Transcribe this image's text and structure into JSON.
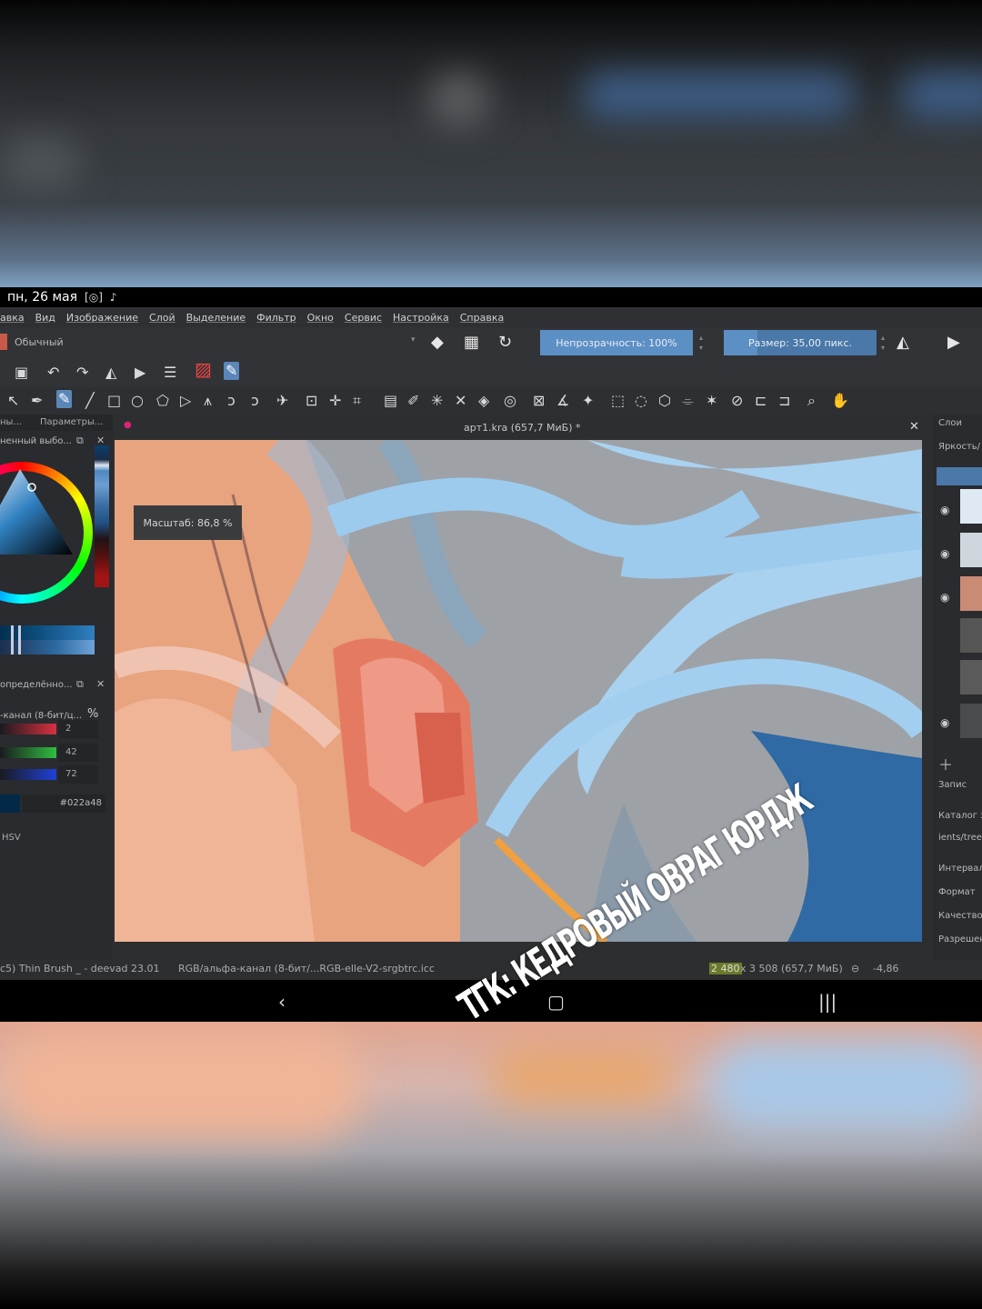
{
  "status_bar": {
    "date": "пн, 26 мая"
  },
  "menu": [
    "авка",
    "Вид",
    "Изображение",
    "Слой",
    "Выделение",
    "Фильтр",
    "Окно",
    "Сервис",
    "Настройка",
    "Справка"
  ],
  "brush_toolbar": {
    "preset": "Обычный",
    "opacity_label": "Непрозрачность: 100%",
    "opacity_value": 1.0,
    "size_label": "Размер: 35,00 пикс.",
    "size_fill": 0.22
  },
  "left_docker": {
    "tab1": "ны...",
    "tab2": "Параметры...",
    "color_selector_title": "ненный выбо...",
    "specific_title": "определённо...",
    "channel_mode": "-канал (8-бит/ц...",
    "percent_symbol": "%",
    "channels": [
      {
        "name": "red",
        "value": "2",
        "color": "#d83040"
      },
      {
        "name": "green",
        "value": "42",
        "color": "#2fbf3f"
      },
      {
        "name": "blue",
        "value": "72",
        "color": "#2040d8"
      }
    ],
    "hex": "#022a48",
    "hsv_label": "HSV"
  },
  "document": {
    "title": "арт1.kra (657,7 МиБ)  *",
    "zoom_tooltip": "Масштаб: 86,8 %"
  },
  "right_docker": {
    "layers_title": "Слои",
    "brightness": "Яркость/",
    "record_label": "Запис",
    "catalog": "Каталог з",
    "path": "ients/tree",
    "interval": "Интервал",
    "format": "Формат",
    "quality": "Качество",
    "resolution": "Разрешен"
  },
  "status_line": {
    "brush": "c5) Thin Brush _ - deevad 23.01",
    "color_profile": "RGB/альфа-канал (8-бит/...RGB-elle-V2-srgbtrc.icc",
    "dims_w": "2 480",
    "dims_rest": " x 3 508 (657,7 МиБ)",
    "rotation": "-4,86"
  },
  "watermark": "ТГК: КЕДРОВЫЙ ОВРАГ ЮРДЖ",
  "colors": {
    "accent": "#5b86b8",
    "foreground": "#022a48"
  }
}
